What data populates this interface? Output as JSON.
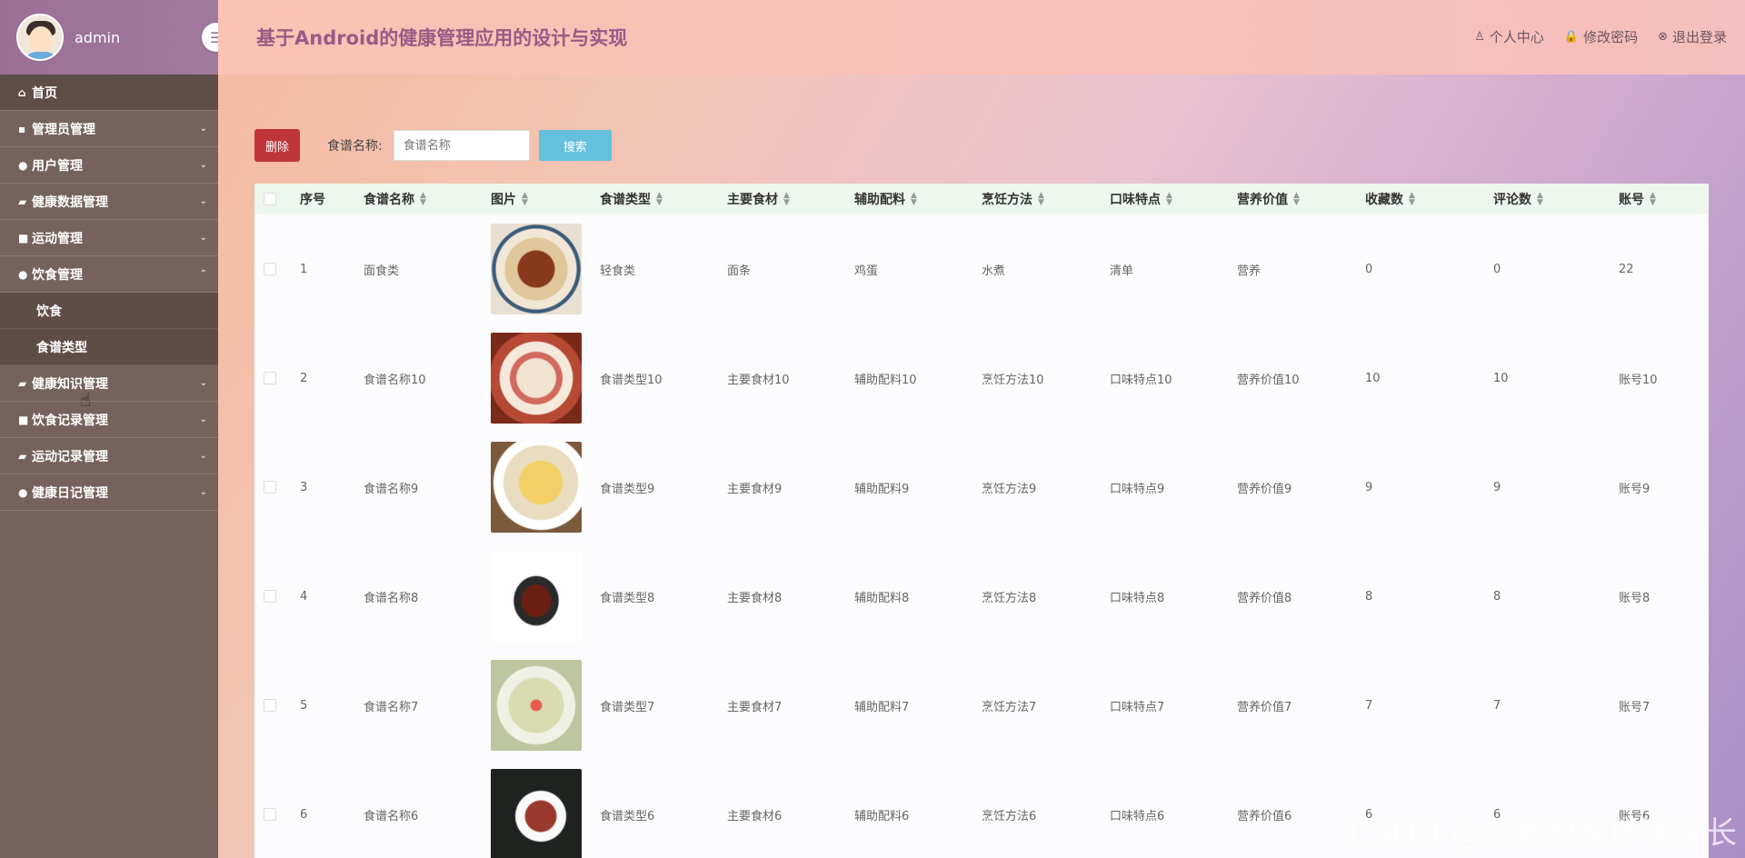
{
  "sidebar": {
    "username": "admin",
    "collapse_icon": "☰",
    "items": [
      {
        "label": "首页",
        "icon": "⌂",
        "has_children": false
      },
      {
        "label": "管理员管理",
        "icon": "▪",
        "has_children": true,
        "chevron": "⌄"
      },
      {
        "label": "用户管理",
        "icon": "●",
        "has_children": true,
        "chevron": "⌄"
      },
      {
        "label": "健康数据管理",
        "icon": "▰",
        "has_children": true,
        "chevron": "⌄"
      },
      {
        "label": "运动管理",
        "icon": "■",
        "has_children": true,
        "chevron": "⌄"
      },
      {
        "label": "饮食管理",
        "icon": "●",
        "has_children": true,
        "chevron": "⌃",
        "expanded": true
      },
      {
        "label": "健康知识管理",
        "icon": "▰",
        "has_children": true,
        "chevron": "⌄"
      },
      {
        "label": "饮食记录管理",
        "icon": "■",
        "has_children": true,
        "chevron": "⌄"
      },
      {
        "label": "运动记录管理",
        "icon": "▰",
        "has_children": true,
        "chevron": "⌄"
      },
      {
        "label": "健康日记管理",
        "icon": "●",
        "has_children": true,
        "chevron": "⌄"
      }
    ],
    "submenu": [
      "饮食",
      "食谱类型"
    ]
  },
  "header": {
    "title": "基于Android的健康管理应用的设计与实现",
    "actions": [
      {
        "label": "个人中心",
        "icon": "♙"
      },
      {
        "label": "修改密码",
        "icon": "🔒"
      },
      {
        "label": "退出登录",
        "icon": "⊗"
      }
    ]
  },
  "toolbar": {
    "delete_label": "删除",
    "search_label": "食谱名称:",
    "search_placeholder": "食谱名称",
    "search_button": "搜索"
  },
  "table": {
    "headers": [
      "序号",
      "食谱名称",
      "图片",
      "食谱类型",
      "主要食材",
      "辅助配料",
      "烹饪方法",
      "口味特点",
      "营养价值",
      "收藏数",
      "评论数",
      "账号"
    ],
    "sort_icon": "▲▼",
    "rows": [
      {
        "idx": "1",
        "name": "面食类",
        "type": "轻食类",
        "ingredient": "面条",
        "auxiliary": "鸡蛋",
        "cooking": "水煮",
        "taste": "清单",
        "nutrition": "营养",
        "favorites": "0",
        "comments": "0",
        "account": "22"
      },
      {
        "idx": "2",
        "name": "食谱名称10",
        "type": "食谱类型10",
        "ingredient": "主要食材10",
        "auxiliary": "辅助配料10",
        "cooking": "烹饪方法10",
        "taste": "口味特点10",
        "nutrition": "营养价值10",
        "favorites": "10",
        "comments": "10",
        "account": "账号10"
      },
      {
        "idx": "3",
        "name": "食谱名称9",
        "type": "食谱类型9",
        "ingredient": "主要食材9",
        "auxiliary": "辅助配料9",
        "cooking": "烹饪方法9",
        "taste": "口味特点9",
        "nutrition": "营养价值9",
        "favorites": "9",
        "comments": "9",
        "account": "账号9"
      },
      {
        "idx": "4",
        "name": "食谱名称8",
        "type": "食谱类型8",
        "ingredient": "主要食材8",
        "auxiliary": "辅助配料8",
        "cooking": "烹饪方法8",
        "taste": "口味特点8",
        "nutrition": "营养价值8",
        "favorites": "8",
        "comments": "8",
        "account": "账号8"
      },
      {
        "idx": "5",
        "name": "食谱名称7",
        "type": "食谱类型7",
        "ingredient": "主要食材7",
        "auxiliary": "辅助配料7",
        "cooking": "烹饪方法7",
        "taste": "口味特点7",
        "nutrition": "营养价值7",
        "favorites": "7",
        "comments": "7",
        "account": "账号7"
      },
      {
        "idx": "6",
        "name": "食谱名称6",
        "type": "食谱类型6",
        "ingredient": "主要食材6",
        "auxiliary": "辅助配料6",
        "cooking": "烹饪方法6",
        "taste": "口味特点6",
        "nutrition": "营养价值6",
        "favorites": "6",
        "comments": "6",
        "account": "账号6"
      }
    ]
  },
  "watermark": "CSDN @计算机程序猿学长",
  "colors": {
    "sidebar_bg": "#75625b",
    "title": "#9a5a86",
    "delete": "#c0353b",
    "search": "#64c0dc"
  }
}
